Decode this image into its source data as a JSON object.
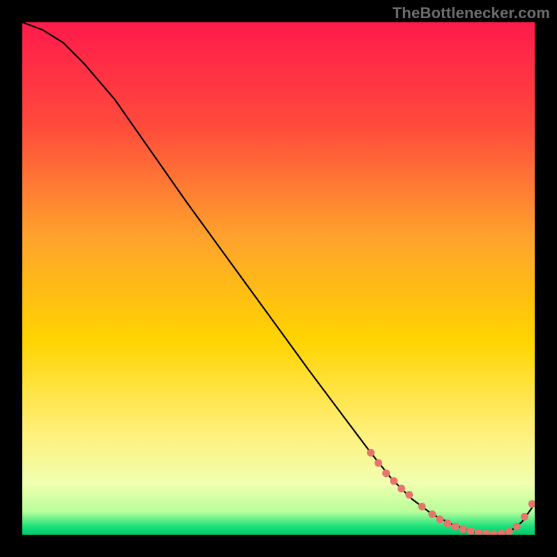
{
  "watermark": "TheBottlenecker.com",
  "colors": {
    "top": "#ff1a4b",
    "mid_upper": "#ff8a2a",
    "mid": "#ffd400",
    "mid_lower": "#fff07a",
    "pale": "#f5ffb8",
    "green": "#16e07a",
    "curve": "#000000",
    "marker": "#e6756b"
  },
  "chart_data": {
    "type": "line",
    "title": "",
    "xlabel": "",
    "ylabel": "",
    "xlim": [
      0,
      100
    ],
    "ylim": [
      0,
      100
    ],
    "curve": {
      "x": [
        0,
        4,
        8,
        12,
        18,
        25,
        32,
        40,
        48,
        56,
        62,
        68,
        72,
        76,
        80,
        84,
        88,
        92,
        95,
        97.5,
        100
      ],
      "y": [
        100,
        98.5,
        96,
        92,
        85,
        75,
        65,
        54,
        43,
        32,
        24,
        16,
        11,
        7,
        4,
        2,
        0.5,
        0,
        0.5,
        2.5,
        6
      ]
    },
    "markers": {
      "x": [
        68,
        69.5,
        71,
        72.5,
        74,
        75.5,
        78,
        80,
        81.5,
        83,
        84.5,
        86,
        87.5,
        89,
        90.5,
        92,
        93.5,
        95,
        96.5,
        98,
        99.5
      ],
      "y": [
        16,
        14,
        12,
        10.5,
        9,
        7.8,
        5.5,
        4,
        3,
        2.2,
        1.6,
        1.1,
        0.7,
        0.4,
        0.2,
        0.1,
        0.2,
        0.6,
        1.6,
        3.5,
        6
      ]
    },
    "gradient_stops": [
      {
        "offset": 0.0,
        "color": "#ff1a4b"
      },
      {
        "offset": 0.2,
        "color": "#ff4a3c"
      },
      {
        "offset": 0.42,
        "color": "#ffa32c"
      },
      {
        "offset": 0.62,
        "color": "#ffd400"
      },
      {
        "offset": 0.8,
        "color": "#fff07a"
      },
      {
        "offset": 0.9,
        "color": "#f0ffb0"
      },
      {
        "offset": 0.955,
        "color": "#b8ff9a"
      },
      {
        "offset": 0.985,
        "color": "#16e07a"
      },
      {
        "offset": 1.0,
        "color": "#00c86a"
      }
    ]
  }
}
